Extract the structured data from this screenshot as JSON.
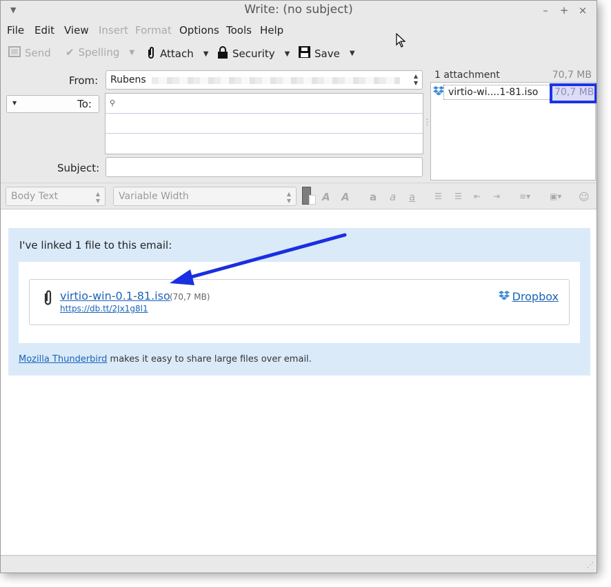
{
  "window": {
    "title": "Write: (no subject)"
  },
  "menubar": {
    "items": [
      "File",
      "Edit",
      "View",
      "Insert",
      "Format",
      "Options",
      "Tools",
      "Help"
    ]
  },
  "toolbar": {
    "send": "Send",
    "spelling": "Spelling",
    "attach": "Attach",
    "security": "Security",
    "save": "Save"
  },
  "header": {
    "from_label": "From:",
    "from_value": "Rubens",
    "to_label": "To:",
    "subject_label": "Subject:",
    "subject_value": ""
  },
  "attachments": {
    "count_label": "1 attachment",
    "total_size": "70,7 MB",
    "items": [
      {
        "name": "virtio-wi....1-81.iso",
        "size": "70,7 MB"
      }
    ]
  },
  "format_bar": {
    "paragraph_style": "Body Text",
    "font": "Variable Width"
  },
  "body": {
    "intro": "I've linked 1 file to this email:",
    "file_name": "virtio-win-0.1-81.iso",
    "file_size": "(70,7 MB)",
    "file_link": "https://db.tt/2Jx1g8l1",
    "service": "Dropbox",
    "footer_link": "Mozilla Thunderbird",
    "footer_text": " makes it easy to share large files over email."
  },
  "colors": {
    "link": "#1a63b8",
    "panel_bg": "#daeaf9",
    "highlight": "#1a33e6",
    "annotation_arrow": "#1a2fe0"
  }
}
